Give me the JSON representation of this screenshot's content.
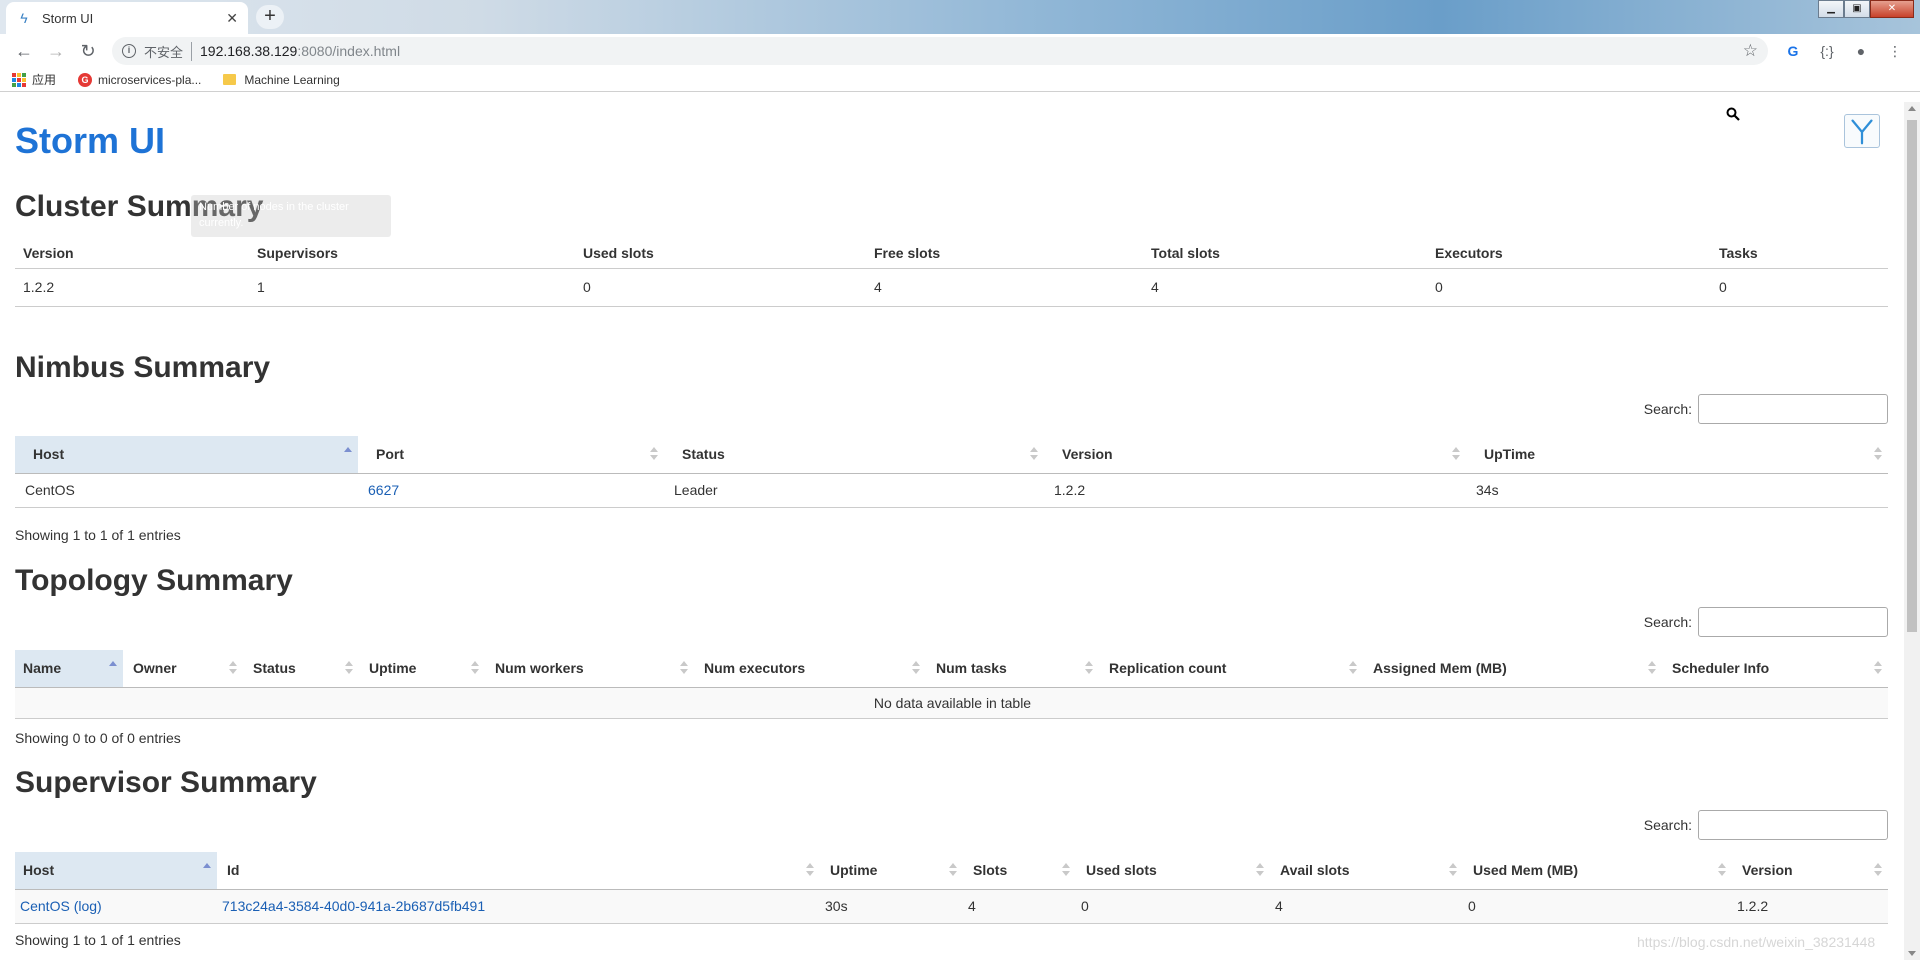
{
  "browser": {
    "tab_title": "Storm UI",
    "tab_close": "✕",
    "new_tab": "+",
    "url_security": "不安全",
    "url_host": "192.168.38.129",
    "url_path": ":8080/index.html",
    "bookmarks": [
      {
        "label": "应用",
        "icon": "apps-icon"
      },
      {
        "label": "microservices-pla...",
        "icon": "g-icon"
      },
      {
        "label": "Machine Learning",
        "icon": "folder-icon"
      }
    ]
  },
  "page": {
    "title": "Storm UI",
    "watermark": "https://blog.csdn.net/weixin_38231448",
    "tooltip": "Number of nodes in the cluster currently."
  },
  "cluster": {
    "heading": "Cluster Summary",
    "headers": [
      "Version",
      "Supervisors",
      "Used slots",
      "Free slots",
      "Total slots",
      "Executors",
      "Tasks"
    ],
    "row": [
      "1.2.2",
      "1",
      "0",
      "4",
      "4",
      "0",
      "0"
    ]
  },
  "nimbus": {
    "heading": "Nimbus Summary",
    "search_label": "Search:",
    "headers": [
      "Host",
      "Port",
      "Status",
      "Version",
      "UpTime"
    ],
    "row": [
      "CentOS",
      "6627",
      "Leader",
      "1.2.2",
      "34s"
    ],
    "info": "Showing 1 to 1 of 1 entries"
  },
  "topology": {
    "heading": "Topology Summary",
    "search_label": "Search:",
    "headers": [
      "Name",
      "Owner",
      "Status",
      "Uptime",
      "Num workers",
      "Num executors",
      "Num tasks",
      "Replication count",
      "Assigned Mem (MB)",
      "Scheduler Info"
    ],
    "empty": "No data available in table",
    "info": "Showing 0 to 0 of 0 entries"
  },
  "supervisor": {
    "heading": "Supervisor Summary",
    "search_label": "Search:",
    "headers": [
      "Host",
      "Id",
      "Uptime",
      "Slots",
      "Used slots",
      "Avail slots",
      "Used Mem (MB)",
      "Version"
    ],
    "row": {
      "host": "CentOS",
      "log": "(log)",
      "id": "713c24a4-3584-40d0-941a-2b687d5fb491",
      "uptime": "30s",
      "slots": "4",
      "used_slots": "0",
      "avail_slots": "4",
      "used_mem": "0",
      "version": "1.2.2"
    },
    "info": "Showing 1 to 1 of 1 entries"
  },
  "colors": {
    "accent": "#1e73d6",
    "link": "#1a5fb4",
    "sorted_header": "#dde8f2"
  }
}
